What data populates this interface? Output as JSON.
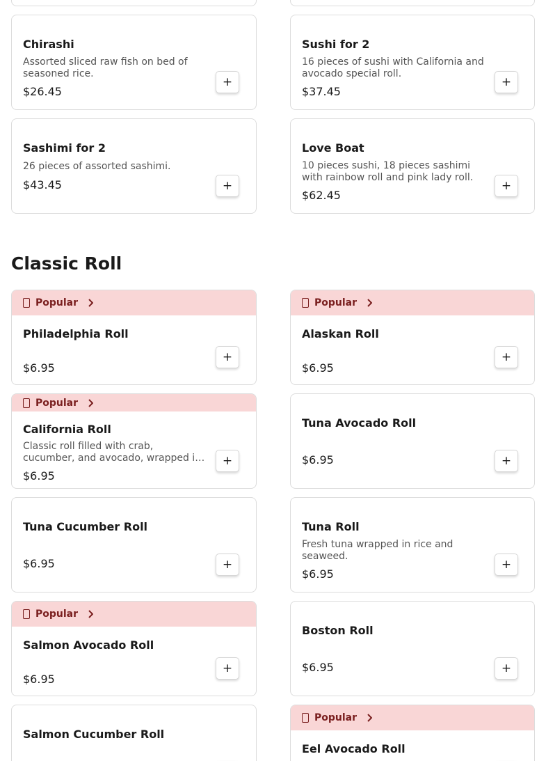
{
  "section": {
    "title": "Classic Roll"
  },
  "labels": {
    "popular": "Popular",
    "add": "+"
  },
  "colors": {
    "popular_bg": "#f9d6d6",
    "popular_text": "#7a1f1f",
    "card_border": "#dcdcdc"
  },
  "items": [
    {
      "name": "",
      "desc": "",
      "price": ""
    },
    {
      "name": "",
      "desc": "",
      "price": ""
    },
    {
      "name": "Chirashi",
      "desc": "Assorted sliced raw fish on bed of seasoned rice.",
      "price": "$26.45"
    },
    {
      "name": "Sushi for 2",
      "desc": "16 pieces of sushi with California and avocado special roll.",
      "price": "$37.45"
    },
    {
      "name": "Sashimi for 2",
      "desc": "26 pieces of assorted sashimi.",
      "price": "$43.45"
    },
    {
      "name": "Love Boat",
      "desc": "10 pieces sushi, 18 pieces sashimi with rainbow roll and pink lady roll.",
      "price": "$62.45"
    },
    {
      "name": "Philadelphia Roll",
      "desc": "",
      "price": "$6.95",
      "popular": true
    },
    {
      "name": "Alaskan Roll",
      "desc": "",
      "price": "$6.95",
      "popular": true
    },
    {
      "name": "California Roll",
      "desc": "Classic roll filled with crab, cucumber, and avocado, wrapped in seaweed and rice.",
      "price": "$6.95",
      "popular": true
    },
    {
      "name": "Tuna Avocado Roll",
      "desc": "",
      "price": "$6.95"
    },
    {
      "name": "Tuna Cucumber Roll",
      "desc": "",
      "price": "$6.95"
    },
    {
      "name": "Tuna Roll",
      "desc": "Fresh tuna wrapped in rice and seaweed.",
      "price": "$6.95"
    },
    {
      "name": "Salmon Avocado Roll",
      "desc": "",
      "price": "$6.95",
      "popular": true
    },
    {
      "name": "Boston Roll",
      "desc": "",
      "price": "$6.95"
    },
    {
      "name": "Salmon Cucumber Roll",
      "desc": "",
      "price": ""
    },
    {
      "name": "Eel Avocado Roll",
      "desc": "",
      "price": "",
      "popular": true
    }
  ]
}
